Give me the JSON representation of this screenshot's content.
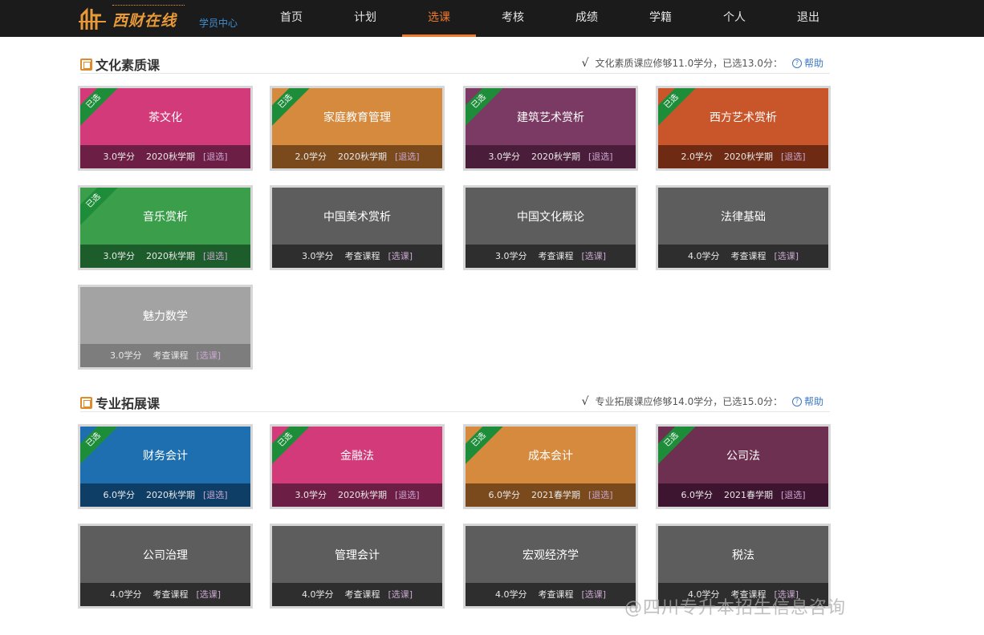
{
  "header": {
    "logo_text": "西财在线",
    "student_center": "学员中心",
    "nav": [
      {
        "label": "首页",
        "active": false
      },
      {
        "label": "计划",
        "active": false
      },
      {
        "label": "选课",
        "active": true
      },
      {
        "label": "考核",
        "active": false
      },
      {
        "label": "成绩",
        "active": false
      },
      {
        "label": "学籍",
        "active": false
      },
      {
        "label": "个人",
        "active": false
      },
      {
        "label": "退出",
        "active": false
      }
    ]
  },
  "sections": [
    {
      "title": "文化素质课",
      "info": "文化素质课应修够11.0学分，已选13.0分：",
      "help": "帮助",
      "courses": [
        {
          "name": "茶文化",
          "credits": "3.0学分",
          "term": "2020秋学期",
          "action": "[退选]",
          "selected": true,
          "badge": "已选",
          "color": "pink"
        },
        {
          "name": "家庭教育管理",
          "credits": "2.0学分",
          "term": "2020秋学期",
          "action": "[退选]",
          "selected": true,
          "badge": "已选",
          "color": "orange"
        },
        {
          "name": "建筑艺术赏析",
          "credits": "3.0学分",
          "term": "2020秋学期",
          "action": "[退选]",
          "selected": true,
          "badge": "已选",
          "color": "purple"
        },
        {
          "name": "西方艺术赏析",
          "credits": "2.0学分",
          "term": "2020秋学期",
          "action": "[退选]",
          "selected": true,
          "badge": "已选",
          "color": "rust"
        },
        {
          "name": "音乐赏析",
          "credits": "3.0学分",
          "term": "2020秋学期",
          "action": "[退选]",
          "selected": true,
          "badge": "已选",
          "color": "green"
        },
        {
          "name": "中国美术赏析",
          "credits": "3.0学分",
          "term": "考查课程",
          "action": "[选课]",
          "selected": false,
          "badge": "",
          "color": "gray"
        },
        {
          "name": "中国文化概论",
          "credits": "3.0学分",
          "term": "考查课程",
          "action": "[选课]",
          "selected": false,
          "badge": "",
          "color": "gray"
        },
        {
          "name": "法律基础",
          "credits": "4.0学分",
          "term": "考查课程",
          "action": "[选课]",
          "selected": false,
          "badge": "",
          "color": "gray"
        },
        {
          "name": "魅力数学",
          "credits": "3.0学分",
          "term": "考查课程",
          "action": "[选课]",
          "selected": false,
          "badge": "",
          "color": "light"
        }
      ]
    },
    {
      "title": "专业拓展课",
      "info": "专业拓展课应修够14.0学分，已选15.0分：",
      "help": "帮助",
      "courses": [
        {
          "name": "财务会计",
          "credits": "6.0学分",
          "term": "2020秋学期",
          "action": "[退选]",
          "selected": true,
          "badge": "已选",
          "color": "blue"
        },
        {
          "name": "金融法",
          "credits": "3.0学分",
          "term": "2020秋学期",
          "action": "[退选]",
          "selected": true,
          "badge": "已选",
          "color": "pink"
        },
        {
          "name": "成本会计",
          "credits": "6.0学分",
          "term": "2021春学期",
          "action": "[退选]",
          "selected": true,
          "badge": "已选",
          "color": "orange"
        },
        {
          "name": "公司法",
          "credits": "6.0学分",
          "term": "2021春学期",
          "action": "[退选]",
          "selected": true,
          "badge": "已选",
          "color": "plum"
        },
        {
          "name": "公司治理",
          "credits": "4.0学分",
          "term": "考查课程",
          "action": "[选课]",
          "selected": false,
          "badge": "",
          "color": "gray"
        },
        {
          "name": "管理会计",
          "credits": "4.0学分",
          "term": "考查课程",
          "action": "[选课]",
          "selected": false,
          "badge": "",
          "color": "gray"
        },
        {
          "name": "宏观经济学",
          "credits": "4.0学分",
          "term": "考查课程",
          "action": "[选课]",
          "selected": false,
          "badge": "",
          "color": "gray"
        },
        {
          "name": "税法",
          "credits": "4.0学分",
          "term": "考查课程",
          "action": "[选课]",
          "selected": false,
          "badge": "",
          "color": "gray"
        }
      ]
    }
  ],
  "watermark": "@四川专升本招生信息咨询",
  "colors": {
    "accent": "#f07b2c",
    "topbar": "#1b1b1b",
    "selected_ribbon": "#1e8d3a",
    "help_link": "#3d78c6"
  }
}
